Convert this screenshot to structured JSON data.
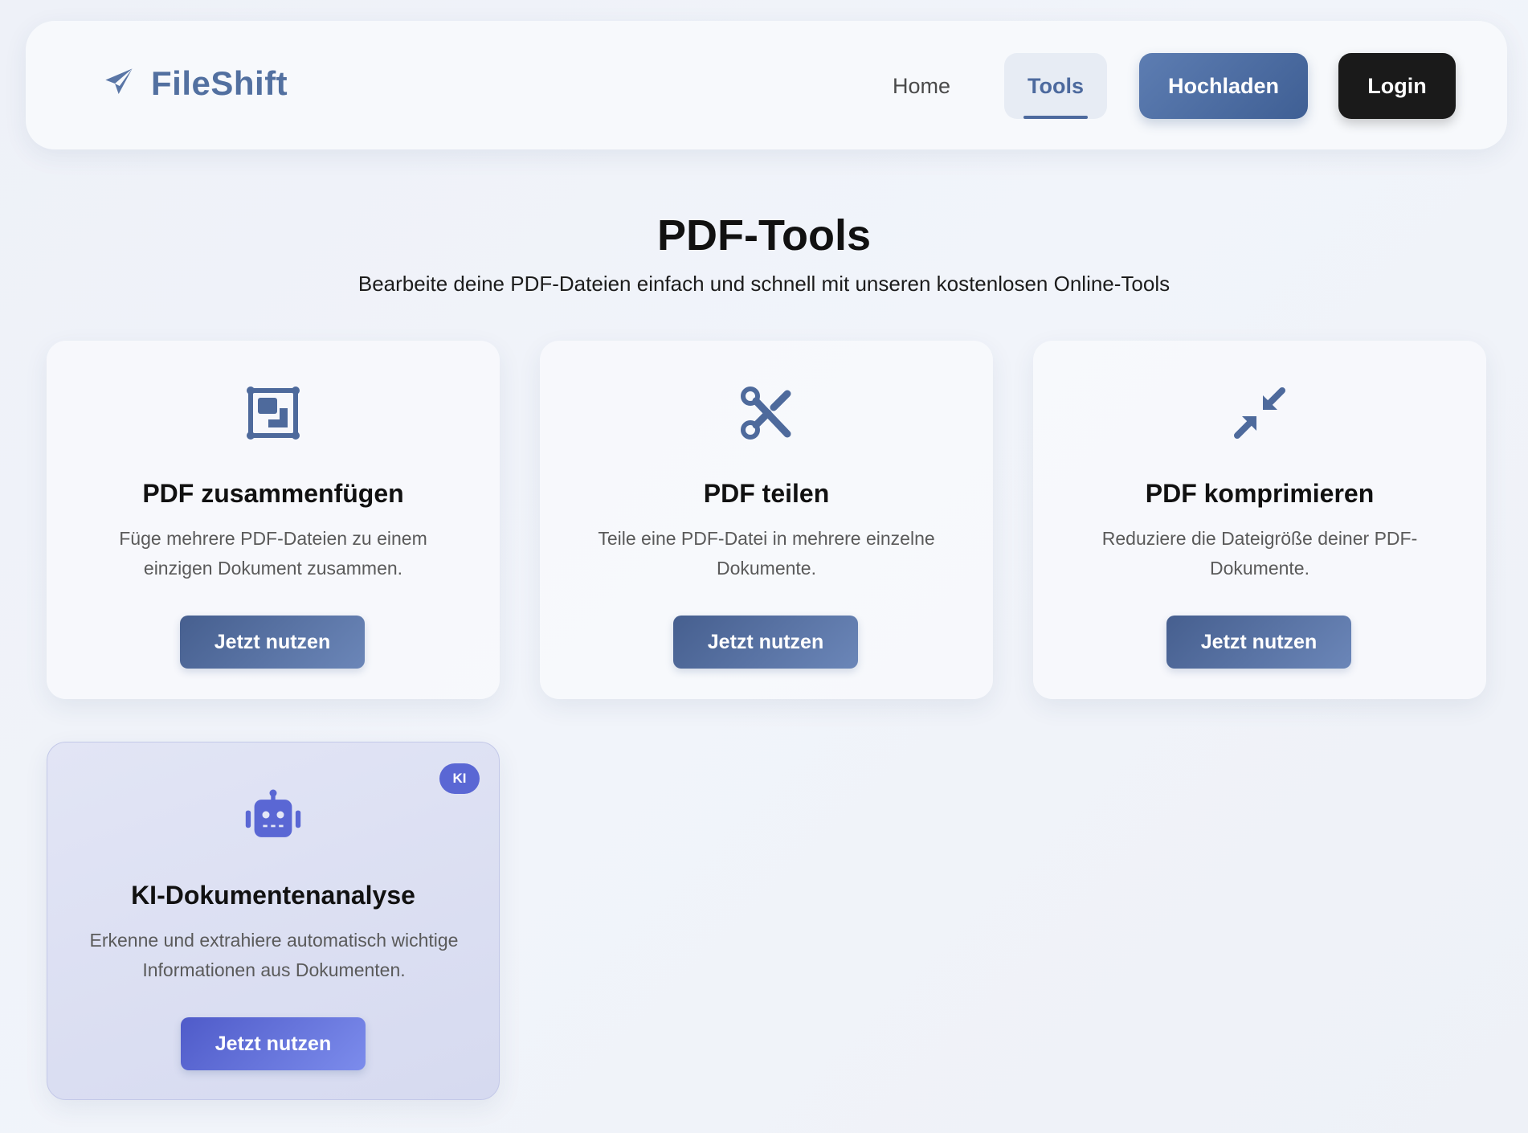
{
  "navbar": {
    "brand": "FileShift",
    "links": {
      "home": "Home",
      "tools": "Tools"
    },
    "upload_label": "Hochladen",
    "login_label": "Login"
  },
  "hero": {
    "title": "PDF-Tools",
    "subtitle": "Bearbeite deine PDF-Dateien einfach und schnell mit unseren kostenlosen Online-Tools"
  },
  "tools": [
    {
      "icon": "merge-icon",
      "title": "PDF zusammenfügen",
      "description": "Füge mehrere PDF-Dateien zu einem einzigen Dokument zusammen.",
      "button": "Jetzt nutzen"
    },
    {
      "icon": "scissors-icon",
      "title": "PDF teilen",
      "description": "Teile eine PDF-Datei in mehrere einzelne Dokumente.",
      "button": "Jetzt nutzen"
    },
    {
      "icon": "compress-icon",
      "title": "PDF komprimieren",
      "description": "Reduziere die Dateigröße deiner PDF-Dokumente.",
      "button": "Jetzt nutzen"
    },
    {
      "icon": "robot-icon",
      "badge": "KI",
      "title": "KI-Dokumentenanalyse",
      "description": "Erkenne und extrahiere automatisch wichtige Informationen aus Dokumenten.",
      "button": "Jetzt nutzen"
    }
  ],
  "colors": {
    "brand": "#5270a0",
    "primary_button": "#4a6596",
    "ai_accent": "#5a67d4",
    "login_button": "#1a1a1a"
  }
}
